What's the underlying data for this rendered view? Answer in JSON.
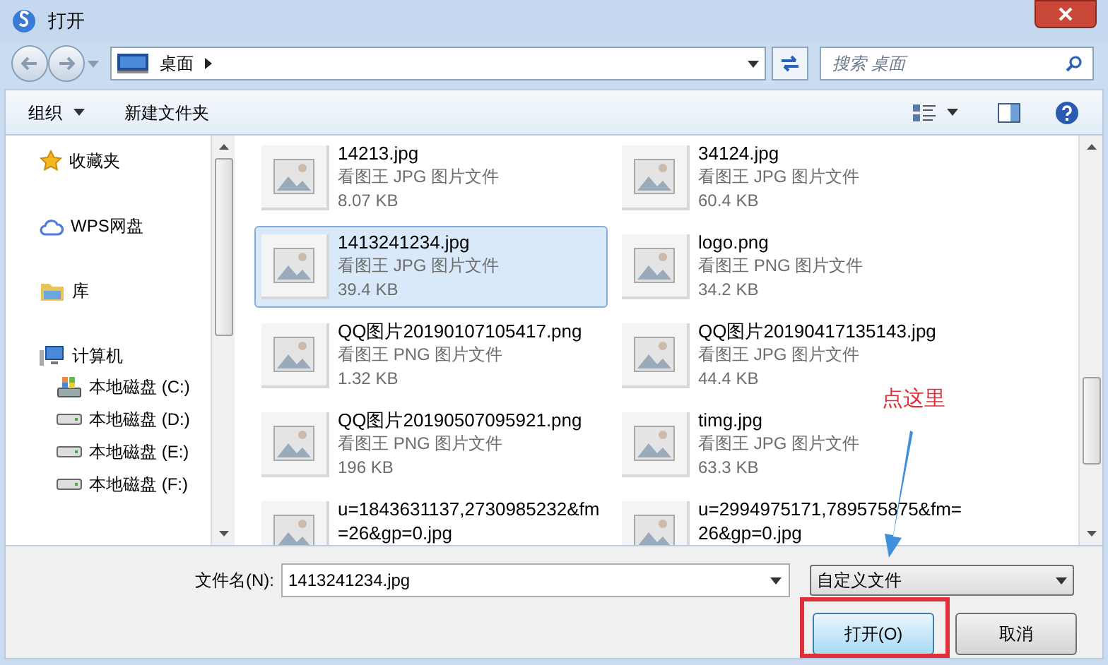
{
  "window": {
    "title": "打开"
  },
  "address_bar": {
    "location": "桌面"
  },
  "search": {
    "placeholder": "搜索 桌面"
  },
  "toolbar": {
    "organize": "组织",
    "new_folder": "新建文件夹"
  },
  "sidebar": {
    "items": [
      {
        "label": "收藏夹",
        "kind": "favorites"
      },
      {
        "label": "WPS网盘",
        "kind": "cloud"
      },
      {
        "label": "库",
        "kind": "library"
      },
      {
        "label": "计算机",
        "kind": "computer",
        "children": [
          {
            "label": "本地磁盘 (C:)",
            "kind": "system-drive"
          },
          {
            "label": "本地磁盘 (D:)",
            "kind": "drive"
          },
          {
            "label": "本地磁盘 (E:)",
            "kind": "drive"
          },
          {
            "label": "本地磁盘 (F:)",
            "kind": "drive"
          }
        ]
      }
    ]
  },
  "files": [
    {
      "name": "14213.jpg",
      "type": "看图王 JPG 图片文件",
      "size": "8.07 KB",
      "selected": false
    },
    {
      "name": "34124.jpg",
      "type": "看图王 JPG 图片文件",
      "size": "60.4 KB",
      "selected": false
    },
    {
      "name": "1413241234.jpg",
      "type": "看图王 JPG 图片文件",
      "size": "39.4 KB",
      "selected": true
    },
    {
      "name": "logo.png",
      "type": "看图王 PNG 图片文件",
      "size": "34.2 KB",
      "selected": false
    },
    {
      "name": "QQ图片20190107105417.png",
      "type": "看图王 PNG 图片文件",
      "size": "1.32 KB",
      "selected": false
    },
    {
      "name": "QQ图片20190417135143.jpg",
      "type": "看图王 JPG 图片文件",
      "size": "44.4 KB",
      "selected": false
    },
    {
      "name": "QQ图片20190507095921.png",
      "type": "看图王 PNG 图片文件",
      "size": "196 KB",
      "selected": false
    },
    {
      "name": "timg.jpg",
      "type": "看图王 JPG 图片文件",
      "size": "63.3 KB",
      "selected": false
    },
    {
      "name": "u=1843631137,2730985232&fm=26&gp=0.jpg",
      "selected": false
    },
    {
      "name": "u=2994975171,789575875&fm=26&gp=0.jpg",
      "selected": false
    }
  ],
  "filename": {
    "label": "文件名(N):",
    "value": "1413241234.jpg"
  },
  "filetype": {
    "value": "自定义文件"
  },
  "buttons": {
    "open": "打开(O)",
    "cancel": "取消"
  },
  "annotation": {
    "text": "点这里"
  }
}
